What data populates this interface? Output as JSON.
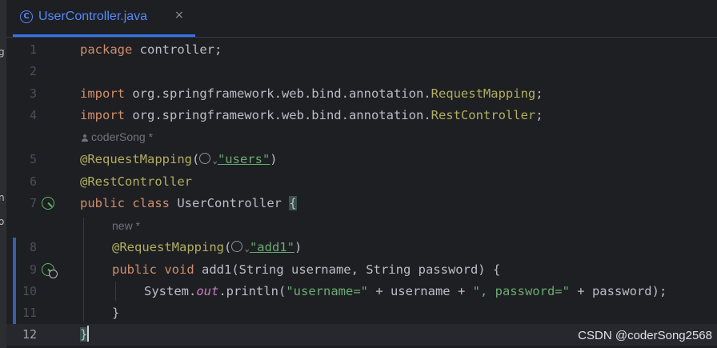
{
  "tab": {
    "icon": "class-c-icon",
    "title": "UserController.java",
    "close_glyph": "×"
  },
  "side_fragments": [
    "g",
    "n",
    "o"
  ],
  "lines": {
    "l1": {
      "num": "1"
    },
    "l2": {
      "num": "2"
    },
    "l3": {
      "num": "3"
    },
    "l4": {
      "num": "4"
    },
    "l5": {
      "num": "5"
    },
    "l6": {
      "num": "6"
    },
    "l7": {
      "num": "7"
    },
    "l8": {
      "num": "8"
    },
    "l9": {
      "num": "9"
    },
    "l10": {
      "num": "10"
    },
    "l11": {
      "num": "11"
    },
    "l12": {
      "num": "12"
    }
  },
  "code": {
    "package_kw": "package",
    "package_name": " controller;",
    "import_kw": "import",
    "import1_pkg": " org.springframework.web.bind.annotation.",
    "import1_cls": "RequestMapping",
    "import2_pkg": " org.springframework.web.bind.annotation.",
    "import2_cls": "RestController",
    "semicolon": ";",
    "req_mapping_ann": "@RequestMapping",
    "open_paren": "(",
    "close_paren": ")",
    "users_str": "\"users\"",
    "rest_controller_ann": "@RestController",
    "public_kw": "public",
    "class_kw": "class",
    "class_name": " UserController ",
    "open_brace": "{",
    "add1_str": "\"add1\"",
    "void_kw": "void",
    "method_sig": " add1(String username, String password) {",
    "system": "System.",
    "out": "out",
    "println": ".println(",
    "username_str": "\"username=\"",
    "plus_username": " + username + ",
    "password_str": "\", password=\"",
    "plus_password": " + password);",
    "close_brace_inner": "}",
    "close_brace_outer": "}"
  },
  "inlay": {
    "author": "coderSong *",
    "new_hint": "new *"
  },
  "watermark": "CSDN @coderSong2568",
  "colors": {
    "background": "#1e1f22",
    "keyword": "#cf8e6d",
    "annotation": "#b3ae60",
    "string": "#6aab73",
    "static_field": "#c77dbb",
    "accent": "#3574f0"
  }
}
